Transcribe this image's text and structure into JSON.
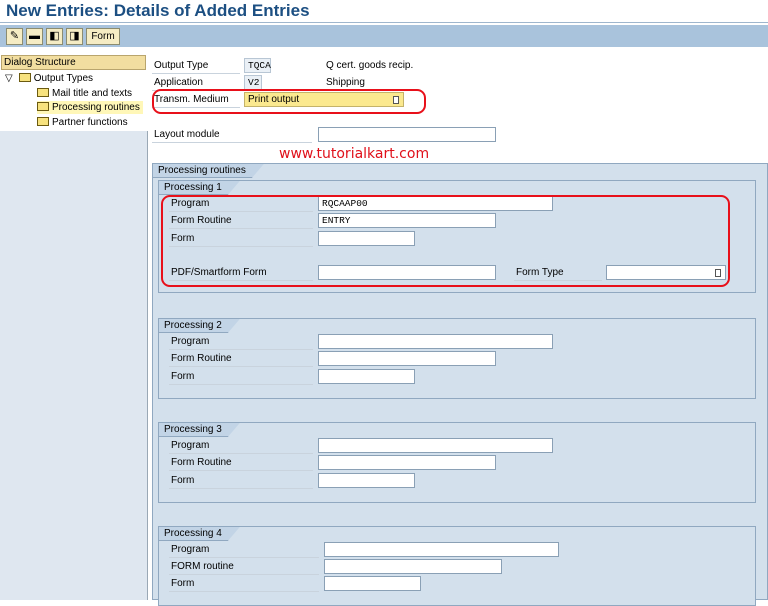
{
  "title": "New Entries: Details of Added Entries",
  "toolbar": {
    "icons": [
      "edit-icon",
      "delete-icon",
      "previous-entry-icon",
      "next-entry-icon"
    ],
    "form_label": "Form"
  },
  "dialog": {
    "heading": "Dialog Structure",
    "root": "Output Types",
    "items": [
      "Mail title and texts",
      "Processing routines",
      "Partner functions"
    ]
  },
  "header": {
    "output_type": {
      "label": "Output Type",
      "value": "TQCA",
      "desc": "Q cert. goods recip."
    },
    "application": {
      "label": "Application",
      "value": "V2",
      "desc": "Shipping"
    },
    "medium": {
      "label": "Transm. Medium",
      "value": "Print output"
    },
    "layout": {
      "label": "Layout module",
      "value": ""
    }
  },
  "watermark": "www.tutorialkart.com",
  "routines": {
    "title": "Processing routines",
    "p1": {
      "title": "Processing 1",
      "program_label": "Program",
      "program": "RQCAAP00",
      "routine_label": "Form Routine",
      "routine": "ENTRY",
      "form_label": "Form",
      "form": "",
      "pdf_label": "PDF/Smartform Form",
      "pdf": "",
      "type_label": "Form Type",
      "type": ""
    },
    "p2": {
      "title": "Processing 2",
      "program_label": "Program",
      "routine_label": "Form Routine",
      "form_label": "Form"
    },
    "p3": {
      "title": "Processing 3",
      "program_label": "Program",
      "routine_label": "Form Routine",
      "form_label": "Form"
    },
    "p4": {
      "title": "Processing 4",
      "program_label": "Program",
      "routine_label": "FORM routine",
      "form_label": "Form"
    }
  },
  "colors": {
    "title": "#1c4f82",
    "highlight": "#e8101a",
    "required": "#fbe98f"
  }
}
